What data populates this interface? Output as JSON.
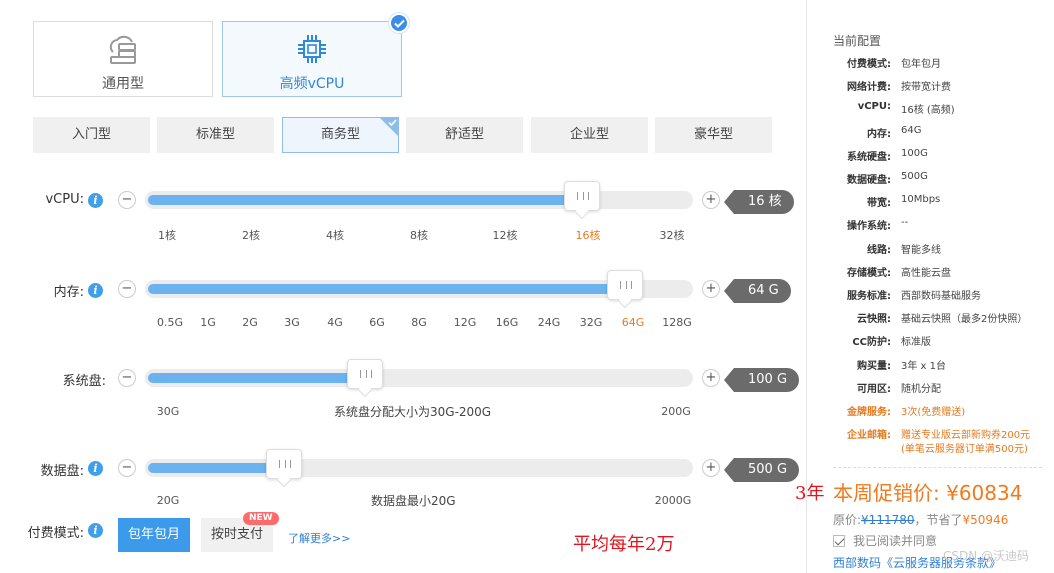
{
  "instance_types": [
    {
      "label": "通用型",
      "icon": "cloud-server-icon",
      "selected": false
    },
    {
      "label": "高频vCPU",
      "icon": "cpu-chip-icon",
      "selected": true
    }
  ],
  "tiers": [
    {
      "label": "入门型",
      "selected": false
    },
    {
      "label": "标准型",
      "selected": false
    },
    {
      "label": "商务型",
      "selected": true
    },
    {
      "label": "舒适型",
      "selected": false
    },
    {
      "label": "企业型",
      "selected": false
    },
    {
      "label": "豪华型",
      "selected": false
    }
  ],
  "sliders": {
    "vcpu": {
      "label": "vCPU:",
      "value": "16 核",
      "level": 0.8,
      "ticks": [
        "1核",
        "2核",
        "4核",
        "8核",
        "12核",
        "16核",
        "32核"
      ],
      "selected_tick": 5
    },
    "memory": {
      "label": "内存:",
      "value": "64 G",
      "level": 0.88,
      "ticks": [
        "0.5G",
        "1G",
        "2G",
        "3G",
        "4G",
        "6G",
        "8G",
        "12G",
        "16G",
        "24G",
        "32G",
        "64G",
        "128G"
      ],
      "selected_tick": 11
    },
    "system_disk": {
      "label": "系统盘:",
      "value": "100 G",
      "level": 0.4,
      "min": "30G",
      "max": "200G",
      "hint": "系统盘分配大小为30G-200G"
    },
    "data_disk": {
      "label": "数据盘:",
      "value": "500 G",
      "level": 0.25,
      "min": "20G",
      "max": "2000G",
      "hint": "数据盘最小20G"
    }
  },
  "pay_mode": {
    "label": "付费模式:",
    "options": [
      "包年包月",
      "按时支付"
    ],
    "new_badge": "NEW",
    "learn_more": "了解更多>>"
  },
  "annotations": {
    "per_year": "平均每年2万",
    "years": "3年"
  },
  "summary": {
    "title": "当前配置",
    "specs": [
      {
        "k": "付费模式:",
        "v": "包年包月"
      },
      {
        "k": "网络计费:",
        "v": "按带宽计费"
      },
      {
        "k": "vCPU:",
        "v": "16核 (高频)"
      },
      {
        "k": "内存:",
        "v": "64G"
      },
      {
        "k": "系统硬盘:",
        "v": "100G"
      },
      {
        "k": "数据硬盘:",
        "v": "500G"
      },
      {
        "k": "带宽:",
        "v": "10Mbps"
      },
      {
        "k": "操作系统:",
        "v": "--"
      },
      {
        "k": "线路:",
        "v": "智能多线"
      },
      {
        "k": "存储模式:",
        "v": "高性能云盘"
      },
      {
        "k": "服务标准:",
        "v": "西部数码基础服务"
      },
      {
        "k": "云快照:",
        "v": "基础云快照（最多2份快照）"
      },
      {
        "k": "CC防护:",
        "v": "标准版"
      },
      {
        "k": "购买量:",
        "v": "3年 x 1台"
      },
      {
        "k": "可用区:",
        "v": "随机分配"
      },
      {
        "k": "金牌服务:",
        "v": "3次(免费赠送)"
      },
      {
        "k": "企业邮箱:",
        "v": "赠送专业版云部新购券200元",
        "v2": "(单笔云服务器订单满500元)"
      }
    ],
    "promo_label": "本周促销价:",
    "promo_price": "¥60834",
    "orig_label": "原价:",
    "orig_price": "¥111780",
    "save_label": "，节省了",
    "save_amount": "¥50946",
    "agree_text": "我已阅读并同意",
    "terms_text": "西部数码《云服务器服务条款》",
    "watermark": "CSDN @沃迪码"
  },
  "colors": {
    "accent": "#3b9ae9",
    "price": "#f07a1e",
    "fill": "#6cb2ee",
    "annotation": "#e0141e"
  }
}
